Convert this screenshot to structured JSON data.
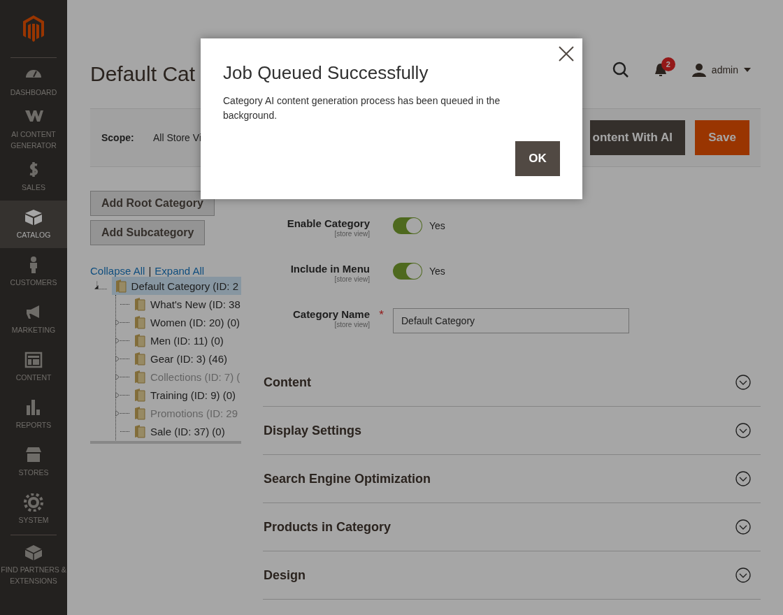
{
  "sidebar": {
    "items": [
      {
        "label": "DASHBOARD",
        "selected": false
      },
      {
        "label": "AI CONTENT GENERATOR",
        "selected": false
      },
      {
        "label": "SALES",
        "selected": false
      },
      {
        "label": "CATALOG",
        "selected": true
      },
      {
        "label": "CUSTOMERS",
        "selected": false
      },
      {
        "label": "MARKETING",
        "selected": false
      },
      {
        "label": "CONTENT",
        "selected": false
      },
      {
        "label": "REPORTS",
        "selected": false
      },
      {
        "label": "STORES",
        "selected": false
      },
      {
        "label": "SYSTEM",
        "selected": false
      }
    ],
    "partners": {
      "label": "FIND PARTNERS & EXTENSIONS"
    }
  },
  "page_title": "Default Cat",
  "header": {
    "notifications": "2",
    "user": "admin"
  },
  "scope": {
    "label": "Scope:",
    "value": "All Store Vi"
  },
  "actions": [
    {
      "label": "ontent With AI",
      "kind": "secondary"
    },
    {
      "label": "Save",
      "kind": "primary"
    }
  ],
  "tree_buttons": [
    "Add Root Category",
    "Add Subcategory"
  ],
  "tree_links": {
    "collapse": "Collapse All",
    "separator": "|",
    "expand": "Expand All"
  },
  "tree": {
    "label": "Default Category (ID: 2",
    "selected": true,
    "expanded": true,
    "children": [
      {
        "label": "What's New (ID: 38",
        "expandable": false,
        "disabled": false
      },
      {
        "label": "Women (ID: 20) (0)",
        "expandable": true,
        "disabled": false
      },
      {
        "label": "Men (ID: 11) (0)",
        "expandable": true,
        "disabled": false
      },
      {
        "label": "Gear (ID: 3) (46)",
        "expandable": true,
        "disabled": false
      },
      {
        "label": "Collections (ID: 7) (",
        "expandable": true,
        "disabled": true
      },
      {
        "label": "Training (ID: 9) (0)",
        "expandable": true,
        "disabled": false
      },
      {
        "label": "Promotions (ID: 29",
        "expandable": true,
        "disabled": true
      },
      {
        "label": "Sale (ID: 37) (0)",
        "expandable": false,
        "disabled": false
      }
    ]
  },
  "fields": [
    {
      "kind": "toggle",
      "label": "Enable Category",
      "scope": "[store view]",
      "on": true,
      "value": "Yes"
    },
    {
      "kind": "toggle",
      "label": "Include in Menu",
      "scope": "[store view]",
      "on": true,
      "value": "Yes"
    },
    {
      "kind": "text",
      "label": "Category Name",
      "scope": "[store view]",
      "required": true,
      "required_mark": "*",
      "value": "Default Category"
    }
  ],
  "sections": [
    "Content",
    "Display Settings",
    "Search Engine Optimization",
    "Products in Category",
    "Design"
  ],
  "modal": {
    "title": "Job Queued Successfully",
    "message": "Category AI content generation process has been queued in the background.",
    "button": "OK"
  }
}
